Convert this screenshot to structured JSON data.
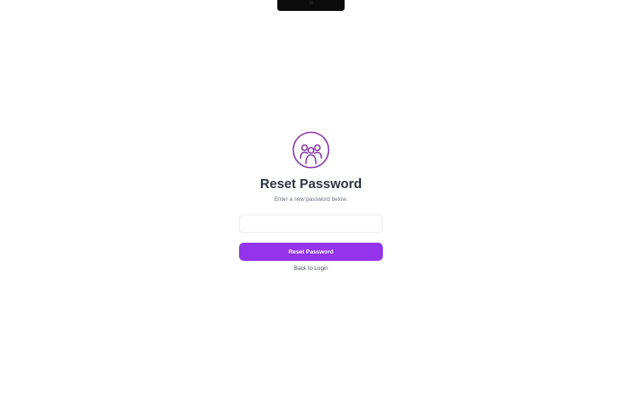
{
  "device": {
    "notch_icon": "camera-icon"
  },
  "brand": {
    "logo_icon": "group-users-icon",
    "accent_color": "#9333ea"
  },
  "form": {
    "title": "Reset Password",
    "subtitle": "Enter a new password below.",
    "password_value": "",
    "password_placeholder": "",
    "submit_label": "Reset Password",
    "back_link_label": "Back to Login"
  }
}
